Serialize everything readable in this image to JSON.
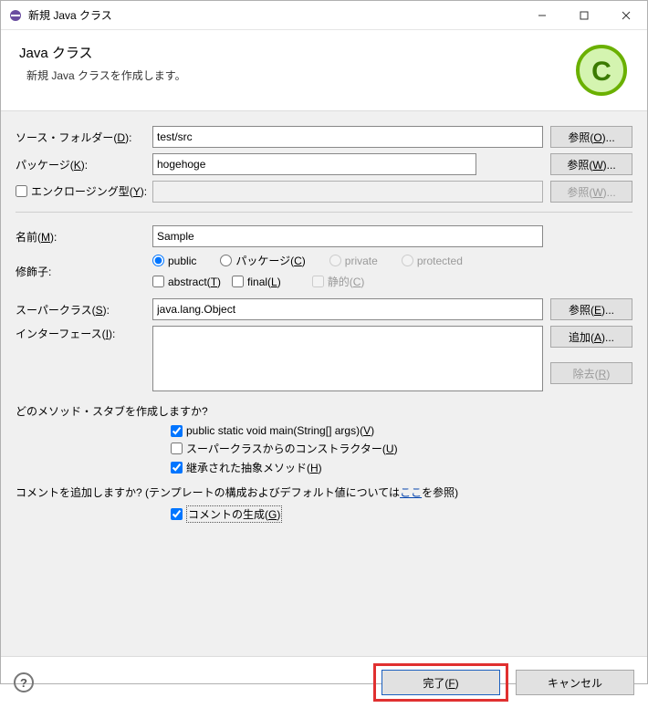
{
  "title": "新規 Java クラス",
  "header": {
    "title": "Java クラス",
    "desc": "新規 Java クラスを作成します。"
  },
  "labels": {
    "source_folder": "ソース・フォルダー(D):",
    "package": "パッケージ(K):",
    "enclosing": "エンクロージング型(Y):",
    "name": "名前(M):",
    "modifiers": "修飾子:",
    "superclass": "スーパークラス(S):",
    "interfaces": "インターフェース(I):",
    "stubs_q": "どのメソッド・スタブを作成しますか?",
    "comments_q_pre": "コメントを追加しますか? (テンプレートの構成およびデフォルト値については",
    "comments_q_link": "ここ",
    "comments_q_post": "を参照)"
  },
  "fields": {
    "source_folder": "test/src",
    "package": "hogehoge",
    "enclosing": "",
    "name": "Sample",
    "superclass": "java.lang.Object"
  },
  "buttons": {
    "browse_o": "参照(O)...",
    "browse_w": "参照(W)...",
    "browse_w2": "参照(W)...",
    "browse_e": "参照(E)...",
    "add_a": "追加(A)...",
    "remove_r": "除去(R)",
    "finish": "完了(F)",
    "cancel": "キャンセル"
  },
  "radios": {
    "public": "public",
    "package": "パッケージ(C)",
    "private": "private",
    "protected": "protected"
  },
  "checks": {
    "abstract": "abstract(T)",
    "final": "final(L)",
    "static": "静的(C)",
    "main": "public static void main(String[] args)(V)",
    "super_ctor": "スーパークラスからのコンストラクター(U)",
    "inherited": "継承された抽象メソッド(H)",
    "gen_comments": "コメントの生成(G)"
  }
}
